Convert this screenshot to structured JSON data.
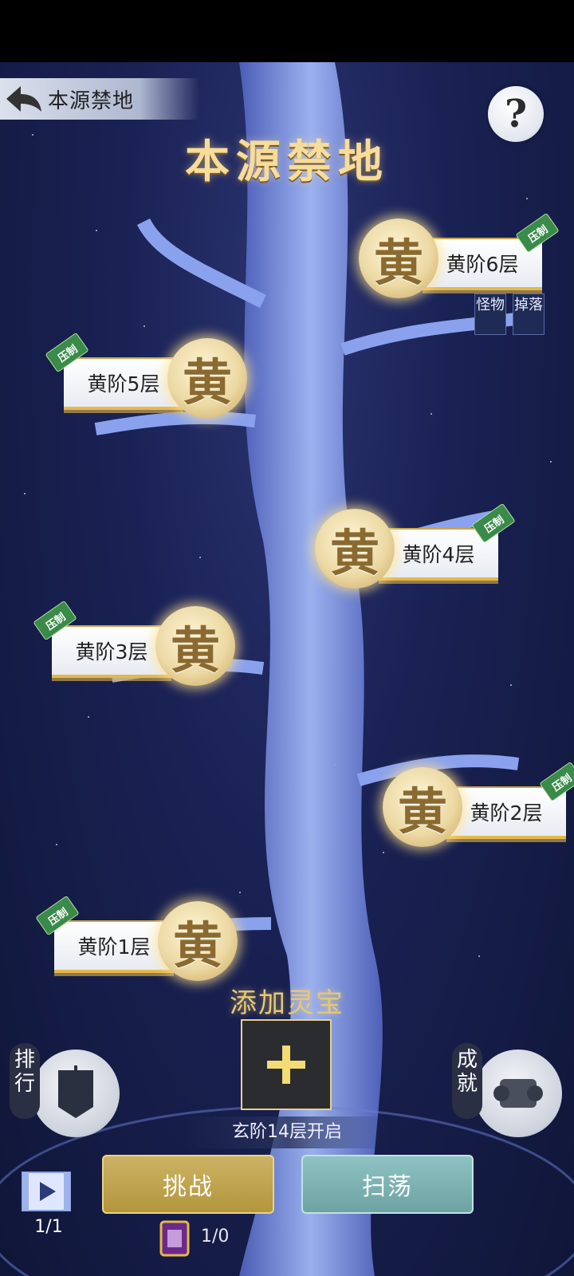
{
  "header": {
    "back_label": "本源禁地",
    "page_title": "本源禁地",
    "help_label": "?"
  },
  "floors": [
    {
      "label": "黄阶6层",
      "medal_char": "黄",
      "tag": "压制"
    },
    {
      "label": "黄阶5层",
      "medal_char": "黄",
      "tag": "压制"
    },
    {
      "label": "黄阶4层",
      "medal_char": "黄",
      "tag": "压制"
    },
    {
      "label": "黄阶3层",
      "medal_char": "黄",
      "tag": "压制"
    },
    {
      "label": "黄阶2层",
      "medal_char": "黄",
      "tag": "压制"
    },
    {
      "label": "黄阶1层",
      "medal_char": "黄",
      "tag": "压制"
    }
  ],
  "floor6_buttons": {
    "monster_label": "怪物",
    "drop_label": "掉落"
  },
  "treasure": {
    "title": "添加灵宝",
    "unlock_text": "玄阶14层开启"
  },
  "side_buttons": {
    "rank_label": "排行",
    "achievement_label": "成就"
  },
  "actions": {
    "challenge_label": "挑战",
    "sweep_label": "扫荡"
  },
  "footer": {
    "replay_count": "1/1",
    "ticket_count": "1/0"
  },
  "colors": {
    "gold": "#e4b84b",
    "challenge": "#b3963c",
    "sweep": "#6ea3a3",
    "tag_green": "#3a8a4a"
  }
}
